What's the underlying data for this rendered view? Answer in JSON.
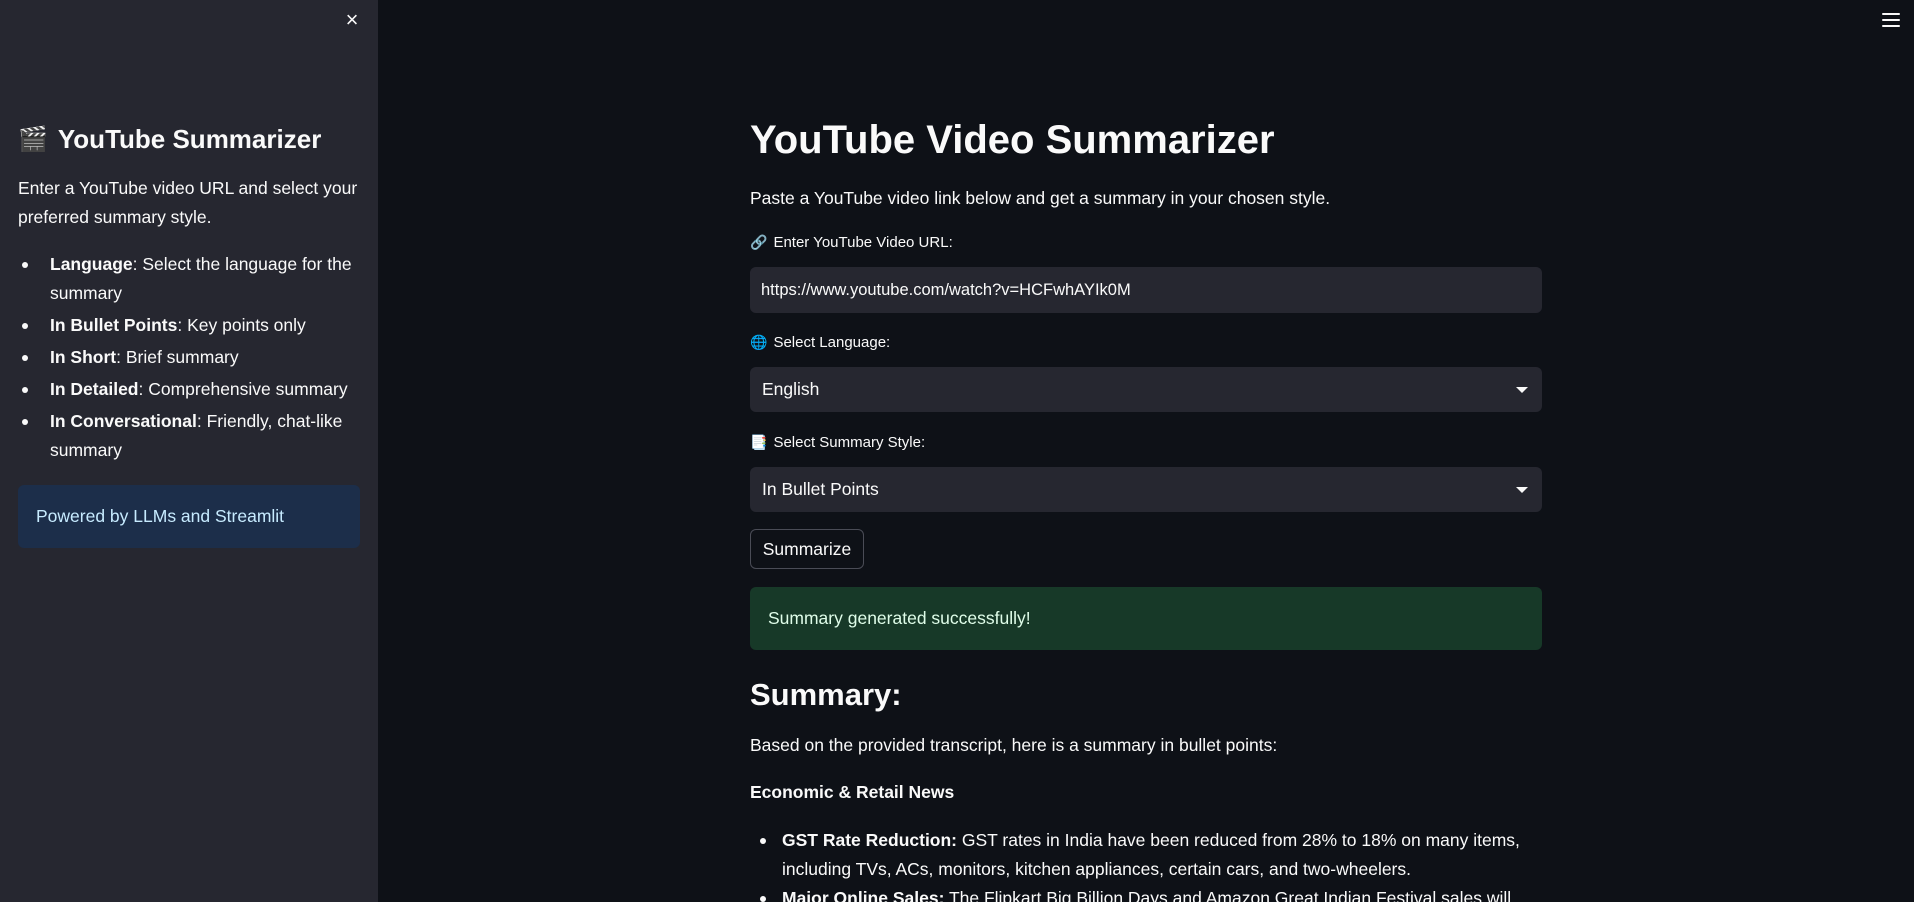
{
  "sidebar": {
    "title_emoji": "🎬",
    "title": "YouTube Summarizer",
    "description": "Enter a YouTube video URL and select your preferred summary style.",
    "items": [
      {
        "bold": "Language",
        "text": ": Select the language for the summary"
      },
      {
        "bold": "In Bullet Points",
        "text": ": Key points only"
      },
      {
        "bold": "In Short",
        "text": ": Brief summary"
      },
      {
        "bold": "In Detailed",
        "text": ": Comprehensive summary"
      },
      {
        "bold": "In Conversational",
        "text": ": Friendly, chat-like summary"
      }
    ],
    "info": "Powered by LLMs and Streamlit",
    "close_icon": "×"
  },
  "main": {
    "title": "YouTube Video Summarizer",
    "subtitle": "Paste a YouTube video link below and get a summary in your chosen style.",
    "url_field": {
      "icon": "🔗",
      "label": "Enter YouTube Video URL:",
      "value": "https://www.youtube.com/watch?v=HCFwhAYIk0M"
    },
    "language_field": {
      "icon": "🌐",
      "label": "Select Language:",
      "value": "English"
    },
    "style_field": {
      "icon": "📑",
      "label": "Select Summary Style:",
      "value": "In Bullet Points"
    },
    "button_label": "Summarize",
    "success_message": "Summary generated successfully!",
    "summary_heading": "Summary:",
    "summary_intro": "Based on the provided transcript, here is a summary in bullet points:",
    "section_heading": "Economic & Retail News",
    "bullets": [
      {
        "bold": "GST Rate Reduction:",
        "text": " GST rates in India have been reduced from 28% to 18% on many items, including TVs, ACs, monitors, kitchen appliances, certain cars, and two-wheelers."
      },
      {
        "bold": "Major Online Sales:",
        "text": " The Flipkart Big Billion Days and Amazon Great Indian Festival sales will begin on"
      }
    ]
  },
  "colors": {
    "background": "#0e1117",
    "sidebar": "#262730",
    "info_bg": "#1c2e4a",
    "success_bg": "#173928"
  }
}
